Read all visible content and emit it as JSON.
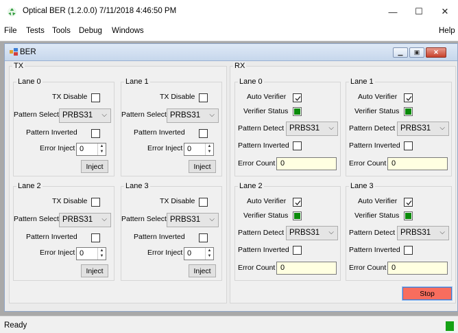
{
  "window": {
    "title": "Optical BER (1.2.0.0) 7/11/2018 4:46:50 PM",
    "minimize_glyph": "—",
    "maximize_glyph": "☐",
    "close_glyph": "✕",
    "icon": "recycle-icon"
  },
  "menu": {
    "file": "File",
    "tests": "Tests",
    "tools": "Tools",
    "debug": "Debug",
    "windows": "Windows",
    "help": "Help"
  },
  "child": {
    "title": "BER",
    "icon": "ber-window-icon",
    "min_glyph": "▁",
    "restore_glyph": "▣",
    "close_glyph": "✕"
  },
  "tx": {
    "label": "TX",
    "lanes": [
      {
        "label": "Lane 0",
        "tx_disable_label": "TX Disable",
        "tx_disable": false,
        "pattern_select_label": "Pattern Select",
        "pattern": "PRBS31",
        "pattern_inverted_label": "Pattern Inverted",
        "pattern_inverted": false,
        "error_inject_label": "Error Inject",
        "error_inject": "0",
        "inject_label": "Inject"
      },
      {
        "label": "Lane 1",
        "tx_disable_label": "TX Disable",
        "tx_disable": false,
        "pattern_select_label": "Pattern Select",
        "pattern": "PRBS31",
        "pattern_inverted_label": "Pattern Inverted",
        "pattern_inverted": false,
        "error_inject_label": "Error Inject",
        "error_inject": "0",
        "inject_label": "Inject"
      },
      {
        "label": "Lane 2",
        "tx_disable_label": "TX Disable",
        "tx_disable": false,
        "pattern_select_label": "Pattern Select",
        "pattern": "PRBS31",
        "pattern_inverted_label": "Pattern Inverted",
        "pattern_inverted": false,
        "error_inject_label": "Error Inject",
        "error_inject": "0",
        "inject_label": "Inject"
      },
      {
        "label": "Lane 3",
        "tx_disable_label": "TX Disable",
        "tx_disable": false,
        "pattern_select_label": "Pattern Select",
        "pattern": "PRBS31",
        "pattern_inverted_label": "Pattern Inverted",
        "pattern_inverted": false,
        "error_inject_label": "Error Inject",
        "error_inject": "0",
        "inject_label": "Inject"
      }
    ]
  },
  "rx": {
    "label": "RX",
    "lanes": [
      {
        "label": "Lane 0",
        "auto_verifier_label": "Auto Verifier",
        "auto_verifier": true,
        "verifier_status_label": "Verifier Status",
        "verifier_status_color": "#0a8a0a",
        "pattern_detect_label": "Pattern Detect",
        "pattern": "PRBS31",
        "pattern_inverted_label": "Pattern Inverted",
        "pattern_inverted": false,
        "error_count_label": "Error Count",
        "error_count": "0"
      },
      {
        "label": "Lane 1",
        "auto_verifier_label": "Auto Verifier",
        "auto_verifier": true,
        "verifier_status_label": "Verifier Status",
        "verifier_status_color": "#0a8a0a",
        "pattern_detect_label": "Pattern Detect",
        "pattern": "PRBS31",
        "pattern_inverted_label": "Pattern Inverted",
        "pattern_inverted": false,
        "error_count_label": "Error Count",
        "error_count": "0"
      },
      {
        "label": "Lane 2",
        "auto_verifier_label": "Auto Verifier",
        "auto_verifier": true,
        "verifier_status_label": "Verifier Status",
        "verifier_status_color": "#0a8a0a",
        "pattern_detect_label": "Pattern Detect",
        "pattern": "PRBS31",
        "pattern_inverted_label": "Pattern Inverted",
        "pattern_inverted": false,
        "error_count_label": "Error Count",
        "error_count": "0"
      },
      {
        "label": "Lane 3",
        "auto_verifier_label": "Auto Verifier",
        "auto_verifier": true,
        "verifier_status_label": "Verifier Status",
        "verifier_status_color": "#0a8a0a",
        "pattern_detect_label": "Pattern Detect",
        "pattern": "PRBS31",
        "pattern_inverted_label": "Pattern Inverted",
        "pattern_inverted": false,
        "error_count_label": "Error Count",
        "error_count": "0"
      }
    ]
  },
  "stop_label": "Stop",
  "status": {
    "text": "Ready",
    "indicator_color": "#14a114"
  },
  "colors": {
    "stop_button": "#f86d5e",
    "error_count_bg": "#ffffe1",
    "status_green": "#0a8a0a"
  }
}
